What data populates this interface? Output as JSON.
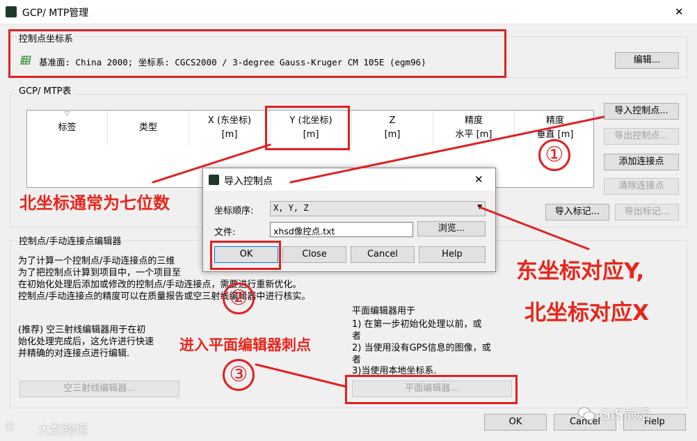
{
  "window": {
    "title": "GCP/ MTP管理",
    "close_glyph": "✕"
  },
  "crs_group": {
    "title": "控制点坐标系",
    "crs_text": "基准面: China 2000; 坐标系: CGCS2000 / 3-degree Gauss-Kruger CM 105E (egm96)",
    "edit_button": "编辑..."
  },
  "table_group": {
    "title": "GCP/ MTP表",
    "columns": [
      {
        "l1": "标签",
        "l2": ""
      },
      {
        "l1": "类型",
        "l2": ""
      },
      {
        "l1": "X (东坐标)",
        "l2": "[m]"
      },
      {
        "l1": "Y (北坐标)",
        "l2": "[m]"
      },
      {
        "l1": "Z",
        "l2": "[m]"
      },
      {
        "l1": "精度",
        "l2": "水平 [m]"
      },
      {
        "l1": "精度",
        "l2": "垂直 [m]"
      }
    ],
    "buttons": {
      "import_gcp": "导入控制点...",
      "export_gcp": "导出控制点...",
      "add_tie": "添加连接点",
      "clear_tie": "清除连接点",
      "import_marks": "导入标记...",
      "export_marks": "导出标记..."
    }
  },
  "editor_group": {
    "title": "控制点/手动连接点编辑器",
    "desc_lines": [
      "为了计算一个控制点/手动连接点的三维",
      "为了把控制点计算到项目中，一个项目至",
      "在初始化处理后添加或修改的控制点/手动连接点，需要进行重新优化。",
      "控制点/手动连接点的精度可以在质量报告或空三射线编辑器中进行核实。"
    ],
    "ray_text": [
      "(推荐) 空三射线编辑器用于在初",
      "始化处理完成后，这允许进行快速",
      "并精确的对连接点进行编辑."
    ],
    "plane_text": [
      "平面编辑器用于",
      "1) 在第一步初始化处理以前，或",
      "者",
      "2) 当使用没有GPS信息的图像，或",
      "者",
      "3)当使用本地坐标系."
    ],
    "ray_button": "空三射线编辑器...",
    "plane_button": "平面编辑器..."
  },
  "footer": {
    "ok": "OK",
    "cancel": "Cancel",
    "help": "Help"
  },
  "dialog": {
    "title": "导入控制点",
    "order_label": "坐标顺序:",
    "order_value": "X, Y, Z",
    "file_label": "文件:",
    "file_value": "xhsd像控点.txt",
    "browse": "浏览...",
    "ok": "OK",
    "close": "Close",
    "cancel": "Cancel",
    "help": "Help",
    "close_glyph": "✕"
  },
  "annotations": {
    "north_note": "北坐标通常为七位数",
    "east_y": "东坐标对应Y,",
    "north_x": "北坐标对应X",
    "enter_plane": "进入平面编辑器刺点",
    "circle1": "①",
    "circle2": "②",
    "circle3": "③"
  },
  "watermarks": {
    "left": "大数跨境",
    "right": "GIS前沿"
  },
  "colors": {
    "annotation_red": "#e02020",
    "window_bg": "#f0f0f0",
    "grid_icon": "#2e8b2e"
  }
}
